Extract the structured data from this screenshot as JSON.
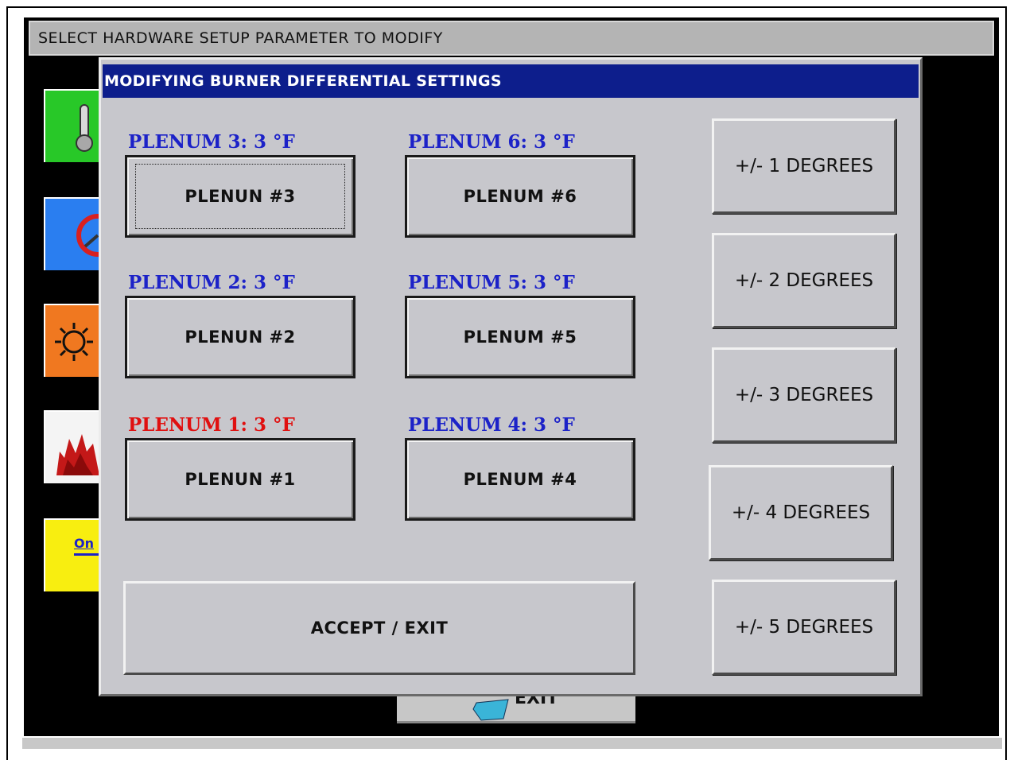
{
  "outer_window": {
    "title": "SELECT HARDWARE SETUP PARAMETER TO MODIFY",
    "side_icons": [
      {
        "name": "thermometer-icon",
        "color": "#28c828"
      },
      {
        "name": "gauge-icon",
        "color": "#2a7ef0"
      },
      {
        "name": "sun-icon",
        "color": "#f07820"
      },
      {
        "name": "flame-icon",
        "color": "#f4f4f4"
      },
      {
        "name": "on-switch-icon",
        "color": "#f8ee10",
        "label": "On"
      }
    ]
  },
  "dialog": {
    "title": "MODIFYING BURNER DIFFERENTIAL SETTINGS",
    "title_bg": "#0d1e8c",
    "plenums": [
      {
        "label": "PLENUM 3:  3 °F",
        "button": "PLENUN  #3",
        "color": "#1c22c8"
      },
      {
        "label": "PLENUM 6:  3 °F",
        "button": "PLENUM  #6",
        "color": "#1c22c8"
      },
      {
        "label": "PLENUM 2:  3 °F",
        "button": "PLENUN  #2",
        "color": "#1c22c8"
      },
      {
        "label": "PLENUM 5:  3 °F",
        "button": "PLENUM  #5",
        "color": "#1c22c8"
      },
      {
        "label": "PLENUM 1:  3 °F",
        "button": "PLENUN  #1",
        "color": "#e01010"
      },
      {
        "label": "PLENUM 4:  3 °F",
        "button": "PLENUM  #4",
        "color": "#1c22c8"
      }
    ],
    "degree_buttons": [
      "+/- 1 DEGREES",
      "+/- 2 DEGREES",
      "+/- 3 DEGREES",
      "+/- 4 DEGREES",
      "+/- 5 DEGREES"
    ],
    "accept_label": "ACCEPT  /  EXIT"
  },
  "behind_exit_label": "EXIT"
}
